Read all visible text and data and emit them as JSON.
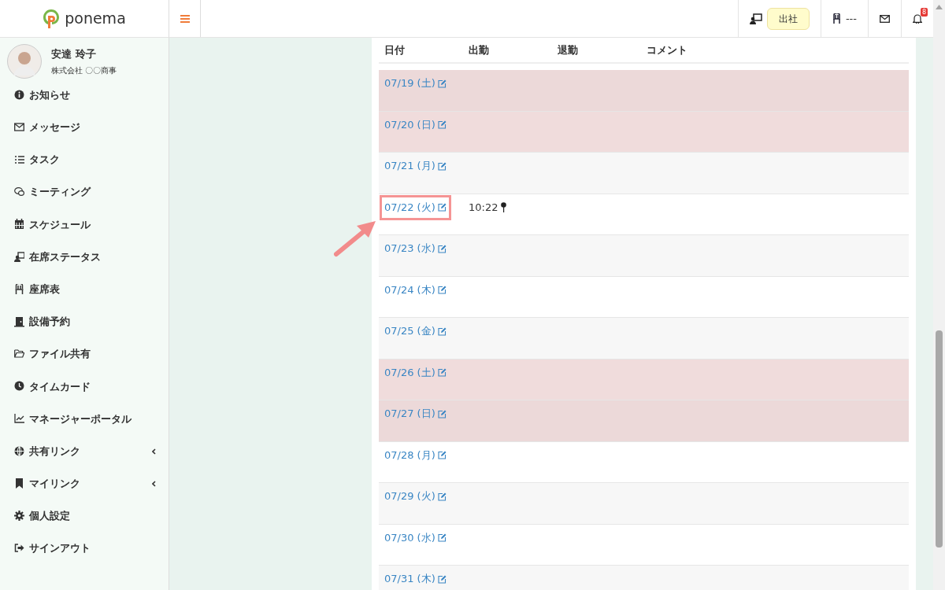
{
  "brand": {
    "name": "ponema"
  },
  "topbar": {
    "status": "出社",
    "seat": "---",
    "notification_count": "8"
  },
  "user": {
    "name": "安達 玲子",
    "company": "株式会社 〇〇商事"
  },
  "sidebar": {
    "items": [
      {
        "label": "お知らせ",
        "kind": "link"
      },
      {
        "label": "メッセージ",
        "kind": "link"
      },
      {
        "label": "タスク",
        "kind": "link"
      },
      {
        "label": "ミーティング",
        "kind": "link"
      },
      {
        "label": "スケジュール",
        "kind": "link"
      },
      {
        "label": "在席ステータス",
        "kind": "link"
      },
      {
        "label": "座席表",
        "kind": "link"
      },
      {
        "label": "設備予約",
        "kind": "link"
      },
      {
        "label": "ファイル共有",
        "kind": "link"
      },
      {
        "label": "タイムカード",
        "kind": "link"
      },
      {
        "label": "マネージャーポータル",
        "kind": "link"
      },
      {
        "label": "共有リンク",
        "kind": "group"
      },
      {
        "label": "マイリンク",
        "kind": "group"
      },
      {
        "label": "個人設定",
        "kind": "link"
      },
      {
        "label": "サインアウト",
        "kind": "link"
      }
    ]
  },
  "table": {
    "columns": [
      "日付",
      "出勤",
      "退勤",
      "コメント"
    ],
    "rows": [
      {
        "date": "07/19 (土)",
        "kind": "holiday",
        "highlighted": false
      },
      {
        "date": "07/20 (日)",
        "kind": "holiday",
        "highlighted": false
      },
      {
        "date": "07/21 (月)",
        "kind": "weekday",
        "highlighted": false
      },
      {
        "date": "07/22 (火)",
        "kind": "weekday",
        "highlighted": true,
        "clock_in": "10:22"
      },
      {
        "date": "07/23 (水)",
        "kind": "weekday",
        "highlighted": false
      },
      {
        "date": "07/24 (木)",
        "kind": "weekday",
        "highlighted": false
      },
      {
        "date": "07/25 (金)",
        "kind": "weekday",
        "highlighted": false
      },
      {
        "date": "07/26 (土)",
        "kind": "holiday",
        "highlighted": false
      },
      {
        "date": "07/27 (日)",
        "kind": "holiday",
        "highlighted": false
      },
      {
        "date": "07/28 (月)",
        "kind": "weekday",
        "highlighted": false
      },
      {
        "date": "07/29 (火)",
        "kind": "weekday",
        "highlighted": false
      },
      {
        "date": "07/30 (水)",
        "kind": "weekday",
        "highlighted": false
      },
      {
        "date": "07/31 (木)",
        "kind": "weekday",
        "highlighted": false
      }
    ]
  }
}
